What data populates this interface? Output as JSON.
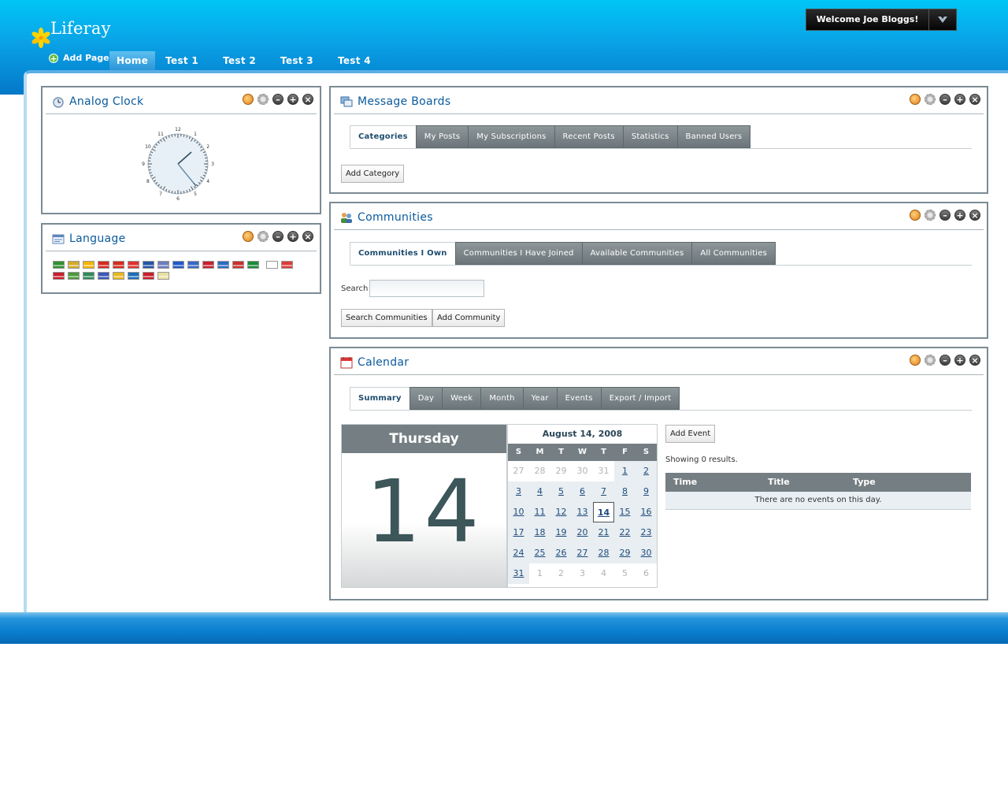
{
  "brand": {
    "name": "Liferay"
  },
  "user_menu": {
    "welcome": "Welcome Joe Bloggs!"
  },
  "add_page": "Add Page",
  "nav": [
    "Home",
    "Test 1",
    "Test 2",
    "Test 3",
    "Test 4"
  ],
  "clock": {
    "title": "Analog Clock",
    "numbers": [
      "12",
      "1",
      "2",
      "3",
      "4",
      "5",
      "6",
      "7",
      "8",
      "9",
      "10",
      "11"
    ]
  },
  "language": {
    "title": "Language",
    "flags": [
      "#2f8f2f",
      "#d4a92a",
      "#f4b400",
      "#d62a1f",
      "#d62a1f",
      "#e03030",
      "#2555a8",
      "#6a7dbd",
      "#1f58c8",
      "#3b66c4",
      "#c7202e",
      "#2b6cc4",
      "#c9302c",
      "#1a8a3a",
      "#ffffff",
      "#dd3b3b",
      "#c81e2c",
      "#4d9a3a",
      "#2e8a5a",
      "#3b57b8",
      "#e5b820",
      "#1b6fb8",
      "#c81e2c",
      "#e8e0a0"
    ]
  },
  "message_boards": {
    "title": "Message Boards",
    "tabs": [
      "Categories",
      "My Posts",
      "My Subscriptions",
      "Recent Posts",
      "Statistics",
      "Banned Users"
    ],
    "add_category": "Add Category"
  },
  "communities": {
    "title": "Communities",
    "tabs": [
      "Communities I Own",
      "Communities I Have Joined",
      "Available Communities",
      "All Communities"
    ],
    "search_label": "Search",
    "search_value": "",
    "search_button": "Search Communities",
    "add_button": "Add Community"
  },
  "calendar": {
    "title": "Calendar",
    "tabs": [
      "Summary",
      "Day",
      "Week",
      "Month",
      "Year",
      "Events",
      "Export / Import"
    ],
    "day_name": "Thursday",
    "day_number": "14",
    "month_header": "August 14, 2008",
    "weekdays": [
      "S",
      "M",
      "T",
      "W",
      "T",
      "F",
      "S"
    ],
    "add_event": "Add Event",
    "results": "Showing 0 results.",
    "columns": [
      "Time",
      "Title",
      "Type"
    ],
    "empty": "There are no events on this day."
  },
  "colors": {
    "accent": "#0a5a9c",
    "header_top": "#00c6f5",
    "header_bottom": "#0478c8",
    "tab_gray": "#757f83"
  }
}
